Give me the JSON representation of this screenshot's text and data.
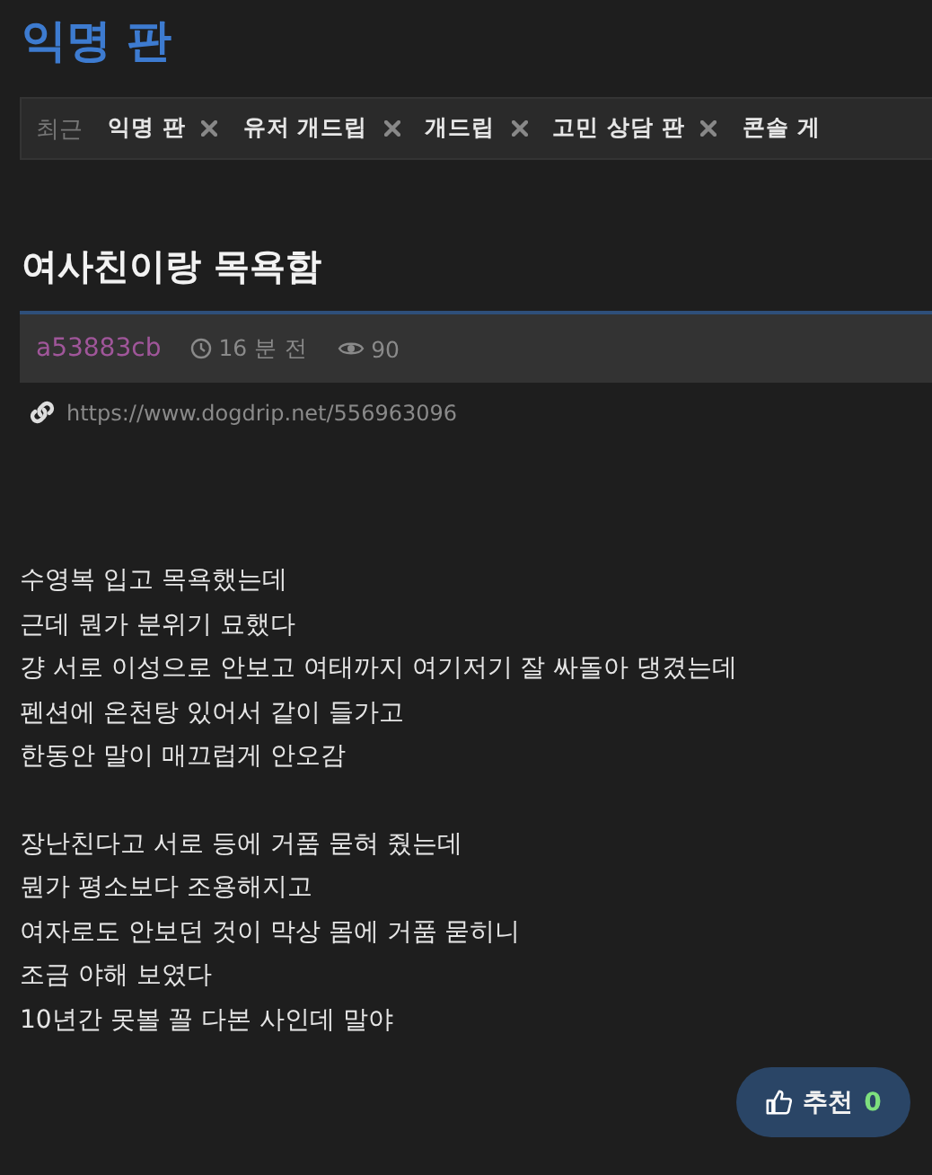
{
  "board_title": "익명 판",
  "recent": {
    "label": "최근",
    "tabs": [
      {
        "label": "익명 판",
        "closable": true
      },
      {
        "label": "유저 개드립",
        "closable": true
      },
      {
        "label": "개드립",
        "closable": true
      },
      {
        "label": "고민 상담 판",
        "closable": true
      },
      {
        "label": "콘솔 게",
        "closable": false
      }
    ]
  },
  "post": {
    "title": "여사친이랑 목욕함",
    "author": "a53883cb",
    "time": "16 분 전",
    "views": "90",
    "url": "https://www.dogdrip.net/556963096",
    "paragraphs": [
      [
        "수영복 입고 목욕했는데",
        "근데 뭔가 분위기 묘했다",
        "걍 서로 이성으로 안보고 여태까지 여기저기 잘 싸돌아 댕겼는데",
        "펜션에 온천탕 있어서 같이 들가고",
        "한동안 말이 매끄럽게 안오감"
      ],
      [
        "장난친다고 서로 등에 거품 묻혀 줬는데",
        "뭔가 평소보다 조용해지고",
        "여자로도 안보던 것이 막상 몸에 거품 묻히니",
        "조금 야해 보였다",
        "10년간 못볼 꼴 다본 사인데 말야"
      ]
    ],
    "recommend": {
      "label": "추천",
      "count": "0"
    }
  }
}
